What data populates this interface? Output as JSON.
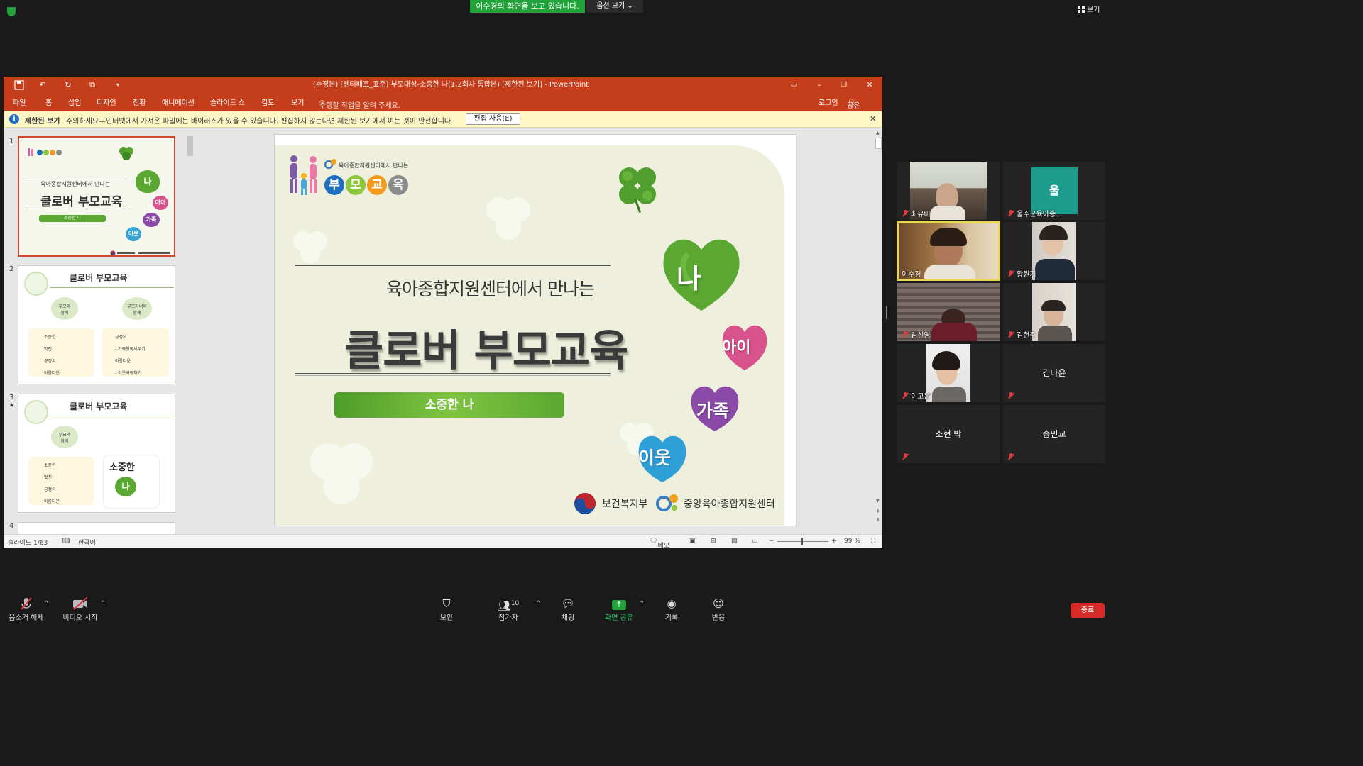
{
  "zoom": {
    "viewing_banner": "이수경의 화면을 보고 있습니다.",
    "view_options": "옵션 보기 ⌄",
    "view_label": "보기",
    "toolbar": [
      {
        "label": "음소거 해제"
      },
      {
        "label": "비디오 시작"
      },
      {
        "label": "보안"
      },
      {
        "label": "참가자",
        "count": "10"
      },
      {
        "label": "채팅"
      },
      {
        "label": "화면 공유"
      },
      {
        "label": "기록"
      },
      {
        "label": "반응"
      }
    ],
    "end_label": "종료"
  },
  "ppt": {
    "title": "(수정본) [센터배포_표준] 부모대상-소중한 나(1,2회차 통합본) [제한된 보기] - PowerPoint",
    "tabs": [
      "파일",
      "홈",
      "삽입",
      "디자인",
      "전환",
      "애니메이션",
      "슬라이드 쇼",
      "검토",
      "보기"
    ],
    "tell_me": "수행할 작업을 알려 주세요.",
    "login": "로그인",
    "share": "공유",
    "info_bold": "제한된 보기",
    "info_text": "주의하세요—인터넷에서 가져온 파일에는 바이러스가 있을 수 있습니다. 편집하지 않는다면 제한된 보기에서 여는 것이 안전합니다.",
    "edit_button": "편집 사용(E)",
    "thumb_numbers": [
      "1",
      "2",
      "3",
      "4"
    ],
    "thumb1": {
      "subtitle": "육아종합지원센터에서 만나는",
      "title": "클로버 부모교육",
      "bar": "소중한 나",
      "words": [
        "나",
        "아이",
        "가족",
        "이웃"
      ]
    },
    "thumb2": {
      "title": "클로버 부모교육",
      "bubble_left": "부모와\n함께",
      "bubble_right": "부모자녀와\n함께",
      "left_items": [
        "소중한",
        "멋진",
        "긍정의",
        "아름다운"
      ],
      "right_items": [
        "긍정의",
        "- 가족행복세우기",
        "아름다운",
        "- 이웃사랑하기"
      ]
    },
    "thumb3": {
      "title": "클로버 부모교육",
      "bubble": "부모와\n함께",
      "items": [
        "소중한",
        "멋진",
        "긍정의",
        "아름다운"
      ],
      "card_title": "소중한",
      "card_word": "나"
    },
    "slide": {
      "logo_caption": "육아종합지원센터에서 만나는",
      "logo_circles": [
        "부",
        "모",
        "교",
        "육"
      ],
      "subtitle": "육아종합지원센터에서 만나는",
      "title": "클로버 부모교육",
      "bar_text": "소중한 나",
      "hearts": [
        "나",
        "아이",
        "가족",
        "이웃"
      ],
      "footer_left": "보건복지부",
      "footer_right": "중앙육아종합지원센터"
    },
    "status": {
      "slide_count": "슬라이드 1/63",
      "language": "한국어",
      "notes": "메모",
      "zoom": "99 %"
    }
  },
  "participants": [
    {
      "name": "최유미",
      "muted": true,
      "video": true
    },
    {
      "name": "울주군육아종...",
      "muted": true,
      "video": false,
      "avatar": "울"
    },
    {
      "name": "이수경",
      "muted": false,
      "video": true,
      "active": true
    },
    {
      "name": "황원기",
      "muted": true,
      "video": true
    },
    {
      "name": "김신영",
      "muted": true,
      "video": true
    },
    {
      "name": "김현주",
      "muted": true,
      "video": true
    },
    {
      "name": "이고운",
      "muted": true,
      "video": true
    },
    {
      "name": "김나윤",
      "muted": true,
      "video": false
    },
    {
      "name": "소현 박",
      "muted": true,
      "video": false
    },
    {
      "name": "송민교",
      "muted": true,
      "video": false
    }
  ],
  "colors": {
    "ppt_red": "#c43e1c",
    "zoom_green": "#22a33a",
    "end_red": "#d92a2a",
    "clover_green": "#5aa832",
    "active_yellow": "#e8d752"
  }
}
